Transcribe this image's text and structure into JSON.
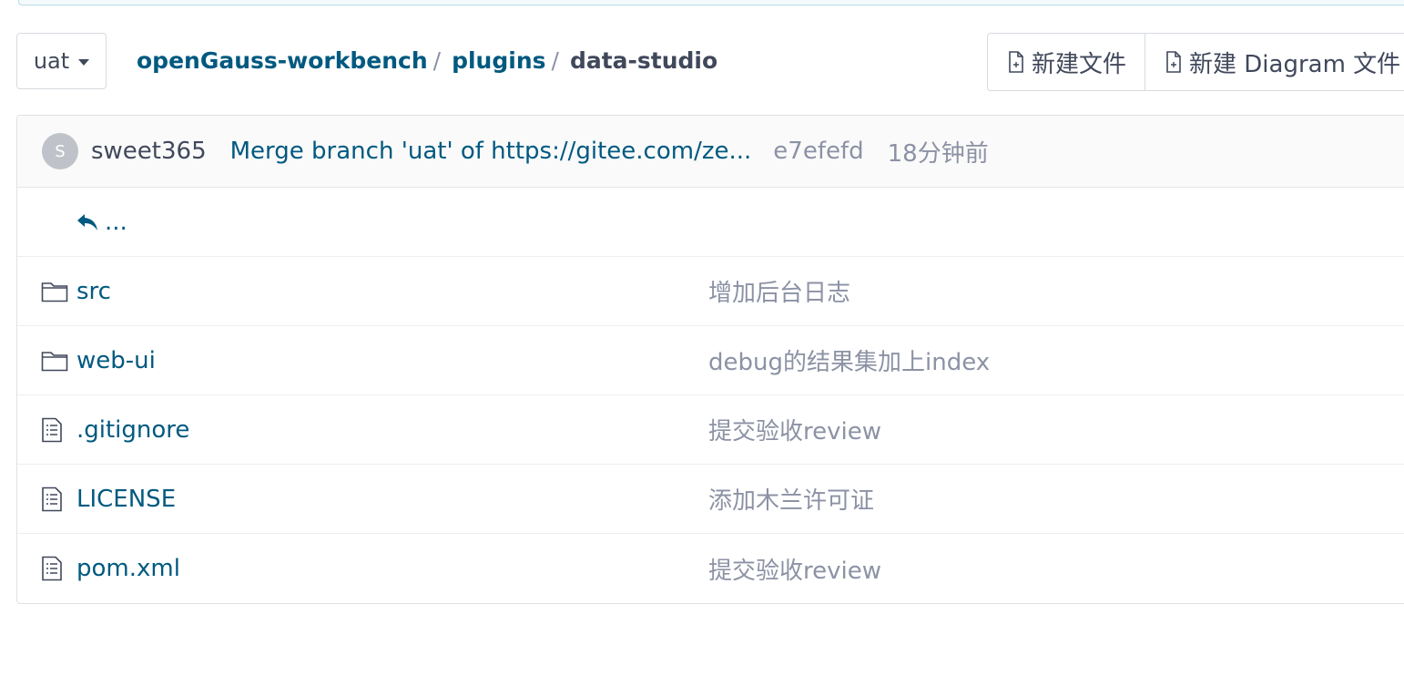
{
  "branch": {
    "name": "uat"
  },
  "breadcrumb": {
    "repo": "openGauss-workbench",
    "folder": "plugins",
    "current": "data-studio",
    "separator": "/"
  },
  "actions": {
    "new_file": "新建文件",
    "new_diagram": "新建 Diagram 文件"
  },
  "commit": {
    "avatar_letter": "S",
    "author": "sweet365",
    "message": "Merge branch 'uat' of https://gitee.com/ze...",
    "sha": "e7efefd",
    "time": "18分钟前"
  },
  "back": {
    "label": "..."
  },
  "files": [
    {
      "name": "src",
      "type": "folder",
      "commit": "增加后台日志"
    },
    {
      "name": "web-ui",
      "type": "folder",
      "commit": "debug的结果集加上index"
    },
    {
      "name": ".gitignore",
      "type": "file",
      "commit": "提交验收review"
    },
    {
      "name": "LICENSE",
      "type": "file",
      "commit": "添加木兰许可证"
    },
    {
      "name": "pom.xml",
      "type": "file",
      "commit": "提交验收review"
    }
  ],
  "colors": {
    "link": "#005980",
    "muted": "#8c92a4",
    "text": "#40485b"
  }
}
